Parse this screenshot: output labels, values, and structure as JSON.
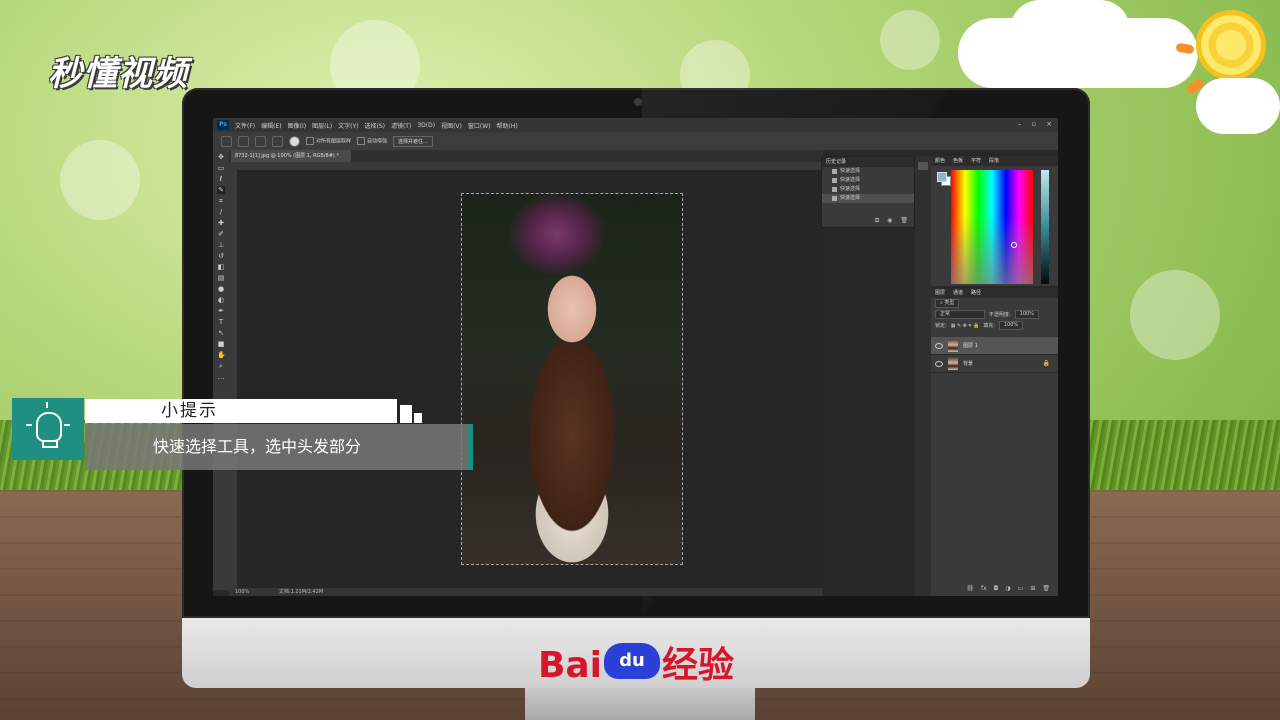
{
  "brand": {
    "logo_text": "秒懂视频"
  },
  "footer": {
    "logo_left": "Bai",
    "logo_paw": "du",
    "logo_right": "经验"
  },
  "tip": {
    "title": "小提示",
    "body": "快速选择工具，选中头发部分"
  },
  "photoshop": {
    "menu": [
      "文件(F)",
      "编辑(E)",
      "图像(I)",
      "图层(L)",
      "文字(Y)",
      "选择(S)",
      "滤镜(T)",
      "3D(D)",
      "视图(V)",
      "窗口(W)",
      "帮助(H)"
    ],
    "options": {
      "sample_all_layers": "对所有图层取样",
      "auto_enhance": "自动增强",
      "select_and_mask": "选择并遮住..."
    },
    "doc_tab": "8732-1[1].jpg @ 100% (图层 1, RGB/8#) *",
    "status": {
      "zoom": "100%",
      "doc_size": "文档:1.21M/2.42M"
    },
    "history": {
      "tab": "历史记录",
      "items": [
        "快速选择",
        "快速选择",
        "快速选择",
        "快速选择"
      ],
      "selected_index": 3
    },
    "color_panel": {
      "tabs": [
        "颜色",
        "色板",
        "字符",
        "段落"
      ],
      "foreground": "#8fb6c8",
      "background": "#ffffff"
    },
    "layers_panel": {
      "tabs": [
        "图层",
        "通道",
        "路径"
      ],
      "filter": "类型",
      "blend_mode": "正常",
      "opacity_label": "不透明度:",
      "opacity_value": "100%",
      "lock_label": "锁定:",
      "fill_label": "填充:",
      "fill_value": "100%",
      "layers": [
        {
          "name": "图层 1",
          "selected": true
        },
        {
          "name": "背景",
          "selected": false,
          "locked": true
        }
      ]
    }
  },
  "colors": {
    "accent": "#1e8f80",
    "baidu_red": "#d6162b",
    "baidu_blue": "#2b40d8"
  }
}
